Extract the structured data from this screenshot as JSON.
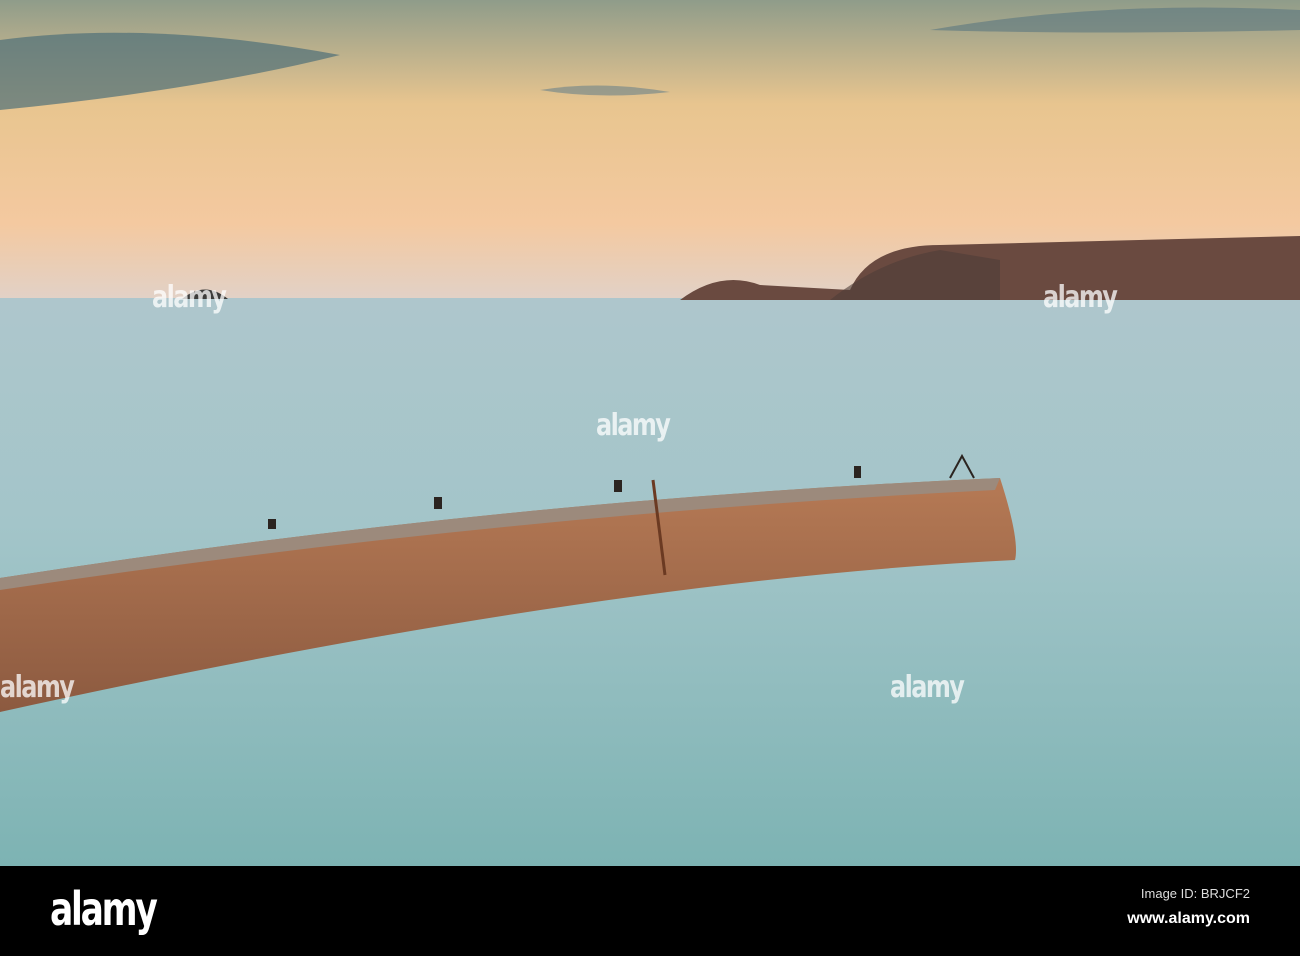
{
  "photo": {
    "subject": "Stone harbour pier in calm long-exposure sea at dusk with distant headland",
    "colors": {
      "sky_top": "#6f8f96",
      "sky_glow": "#f2c08e",
      "sea": "#9fc3c6",
      "sea_near": "#7fb3b5",
      "pier": "#a86a4a"
    }
  },
  "watermark": {
    "text": "alamy"
  },
  "footer": {
    "logo": "alamy",
    "image_id": "Image ID: BRJCF2",
    "site": "www.alamy.com"
  }
}
